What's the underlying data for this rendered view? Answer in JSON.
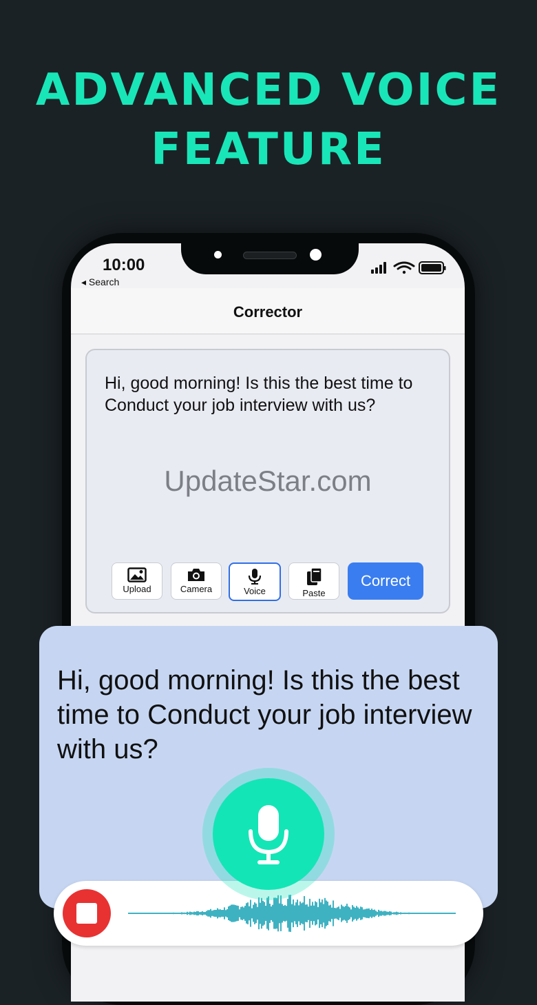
{
  "headline": {
    "line1": "ADVANCED VOICE",
    "line2": "FEATURE"
  },
  "status_bar": {
    "time": "10:00",
    "back_label": "◂ Search"
  },
  "nav": {
    "title": "Corrector"
  },
  "editor": {
    "text": "Hi, good morning! Is this the best time to Conduct your job interview with us?",
    "watermark": "UpdateStar.com"
  },
  "toolbar": {
    "upload": "Upload",
    "camera": "Camera",
    "voice": "Voice",
    "paste": "Paste",
    "correct": "Correct"
  },
  "voice_panel": {
    "text": "Hi, good morning! Is this the best time to Conduct your job interview with us?"
  },
  "colors": {
    "accent": "#19e6b8",
    "background": "#1b2226",
    "button_blue": "#3a7df0",
    "panel": "#c6d6f2",
    "stop_red": "#e83232"
  }
}
